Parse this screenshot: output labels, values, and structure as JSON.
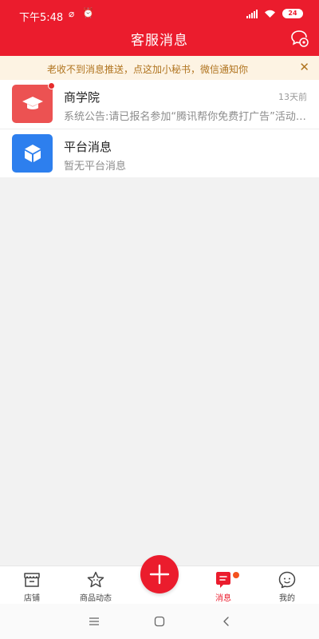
{
  "status_bar": {
    "time": "下午5:48",
    "battery": "24"
  },
  "header": {
    "title": "客服消息",
    "chat_icon": "chat-settings-icon"
  },
  "notice": {
    "text": "老收不到消息推送，点这加小秘书，微信通知你",
    "close": "✕"
  },
  "messages": [
    {
      "title": "商学院",
      "subtitle": "系统公告:请已报名参加“腾讯帮你免费打广告”活动的商家…",
      "time": "13天前",
      "unread": true,
      "icon": "graduation-cap-icon",
      "color": "#ec5252"
    },
    {
      "title": "平台消息",
      "subtitle": "暂无平台消息",
      "time": "",
      "unread": false,
      "icon": "cube-icon",
      "color": "#2d7fee"
    }
  ],
  "tabbar": {
    "tabs": [
      {
        "label": "店铺",
        "icon": "store-icon",
        "active": false
      },
      {
        "label": "商品动态",
        "icon": "star-icon",
        "active": false
      },
      {
        "label": "消息",
        "icon": "message-icon",
        "active": true,
        "badge": true
      },
      {
        "label": "我的",
        "icon": "profile-icon",
        "active": false
      }
    ],
    "center_action": "plus-icon"
  },
  "colors": {
    "brand": "#eb1c2d",
    "notice_bg": "#fdf3e3",
    "notice_text": "#b0741f"
  }
}
